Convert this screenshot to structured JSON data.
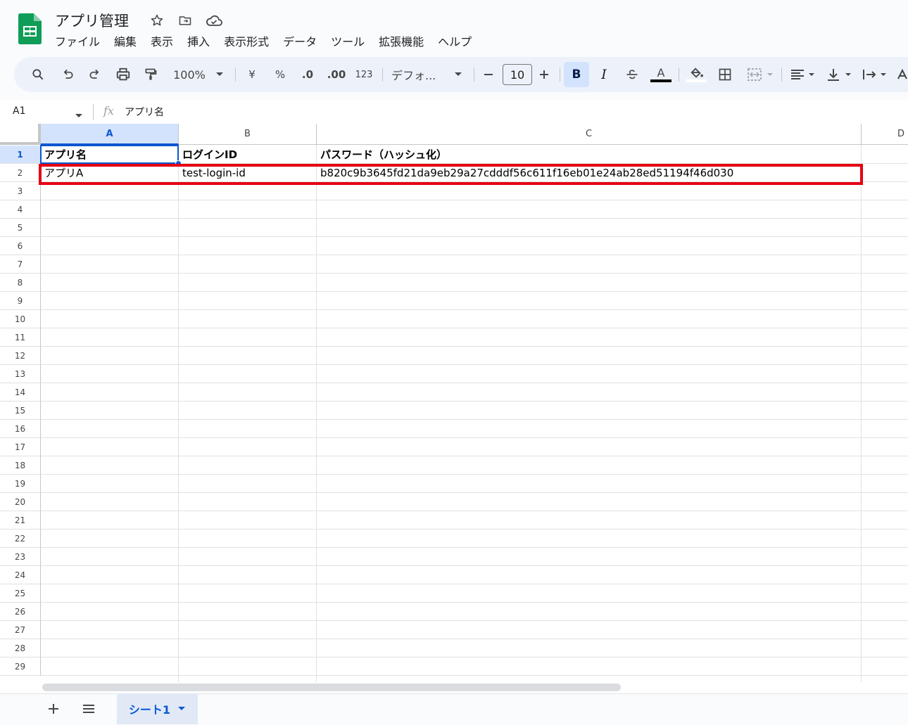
{
  "doc": {
    "title": "アプリ管理"
  },
  "menu": [
    "ファイル",
    "編集",
    "表示",
    "挿入",
    "表示形式",
    "データ",
    "ツール",
    "拡張機能",
    "ヘルプ"
  ],
  "toolbar": {
    "zoom": "100%",
    "currency": "¥",
    "percent": "%",
    "decimal_decrease": ".0",
    "decimal_increase": ".00",
    "number_format": "123",
    "font": "デフォ...",
    "font_size": "10",
    "bold": "B",
    "italic": "I",
    "text_color_label": "A"
  },
  "formula_bar": {
    "cell_ref": "A1",
    "fx": "fx",
    "content": "アプリ名"
  },
  "columns": [
    "A",
    "B",
    "C",
    "D"
  ],
  "rows": [
    "1",
    "2",
    "3",
    "4",
    "5",
    "6",
    "7",
    "8",
    "9",
    "10",
    "11",
    "12",
    "13",
    "14",
    "15",
    "16",
    "17",
    "18",
    "19",
    "20",
    "21",
    "22",
    "23",
    "24",
    "25",
    "26",
    "27",
    "28",
    "29"
  ],
  "cells": {
    "A1": "アプリ名",
    "B1": "ログインID",
    "C1": "パスワード（ハッシュ化）",
    "A2": "アプリA",
    "B2": "test-login-id",
    "C2": "b820c9b3645fd21da9eb29a27cdddf56c611f16eb01e24ab28ed51194f46d030"
  },
  "sheets": [
    {
      "name": "シート1",
      "active": true
    }
  ],
  "colors": {
    "brand_green": "#0f9d58",
    "accent_blue": "#0b57d0",
    "highlight_red": "#e60012"
  }
}
